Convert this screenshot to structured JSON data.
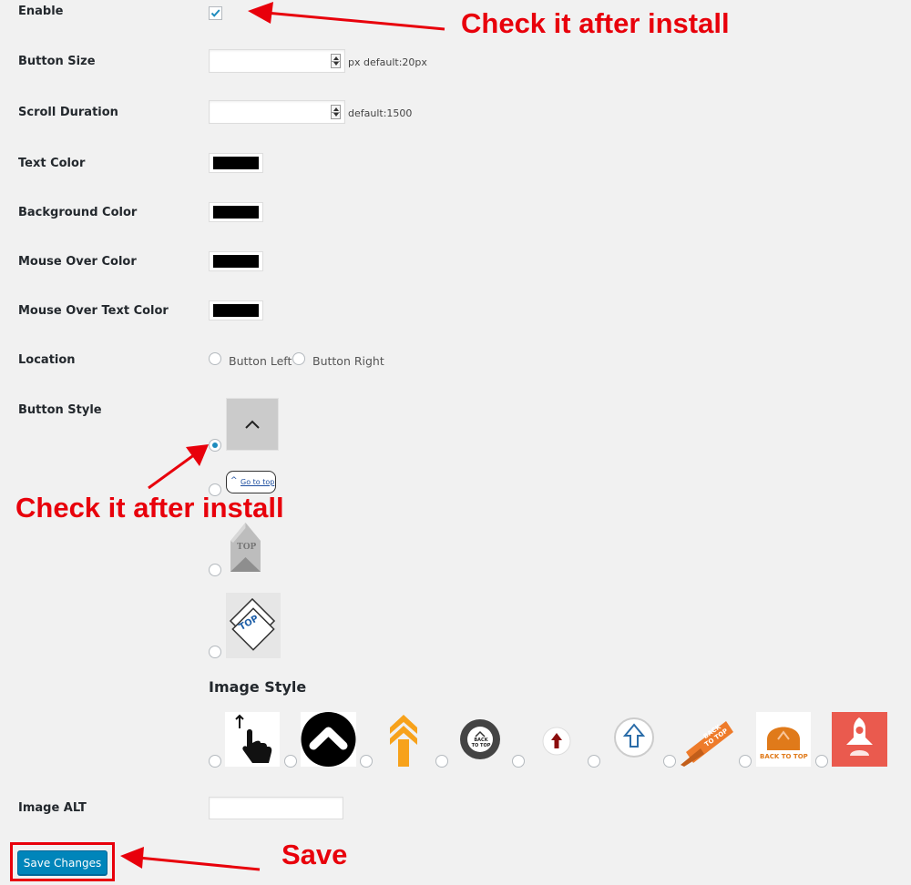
{
  "fields": {
    "enable": "Enable",
    "button_size": "Button Size",
    "scroll_duration": "Scroll Duration",
    "text_color": "Text Color",
    "background_color": "Background Color",
    "mouse_over_color": "Mouse Over Color",
    "mouse_over_text_color": "Mouse Over Text Color",
    "location": "Location",
    "button_style": "Button Style",
    "image_alt": "Image ALT"
  },
  "inputs": {
    "button_size_value": "",
    "button_size_hint": "px default:20px",
    "scroll_duration_value": "",
    "scroll_duration_hint": "default:1500",
    "image_alt_value": ""
  },
  "colors": {
    "text_color": "#000000",
    "background_color": "#000000",
    "mouse_over_color": "#000000",
    "mouse_over_text_color": "#000000",
    "accent": "#0085ba",
    "annotation": "#e8000b"
  },
  "enable_checked": true,
  "location": {
    "option_left": "Button Left",
    "option_right": "Button Right",
    "selected": null
  },
  "button_styles": {
    "selected_index": 0,
    "goto_label": "Go to top",
    "top_label": "TOP",
    "diamond_label": "TOP",
    "items": [
      "chevron-up-button",
      "go-to-top-pill",
      "top-house-arrow",
      "top-diamond"
    ]
  },
  "image_style": {
    "heading": "Image Style",
    "back_to_top_label_1": "BACK TO TOP",
    "back_to_top_label_2": "BACK TO TOP",
    "back_to_top_label_3": "BACK TO TOP",
    "items": [
      "hand-pointer",
      "black-circle-chevron",
      "orange-double-arrow",
      "back-to-top-badge",
      "red-arrow-button",
      "blue-arrow-circle",
      "orange-ribbon",
      "orange-arch",
      "red-rocket"
    ]
  },
  "save_label": "Save Changes",
  "annotations": {
    "check_top": "Check it after install",
    "check_middle": "Check it after install",
    "save": "Save"
  }
}
